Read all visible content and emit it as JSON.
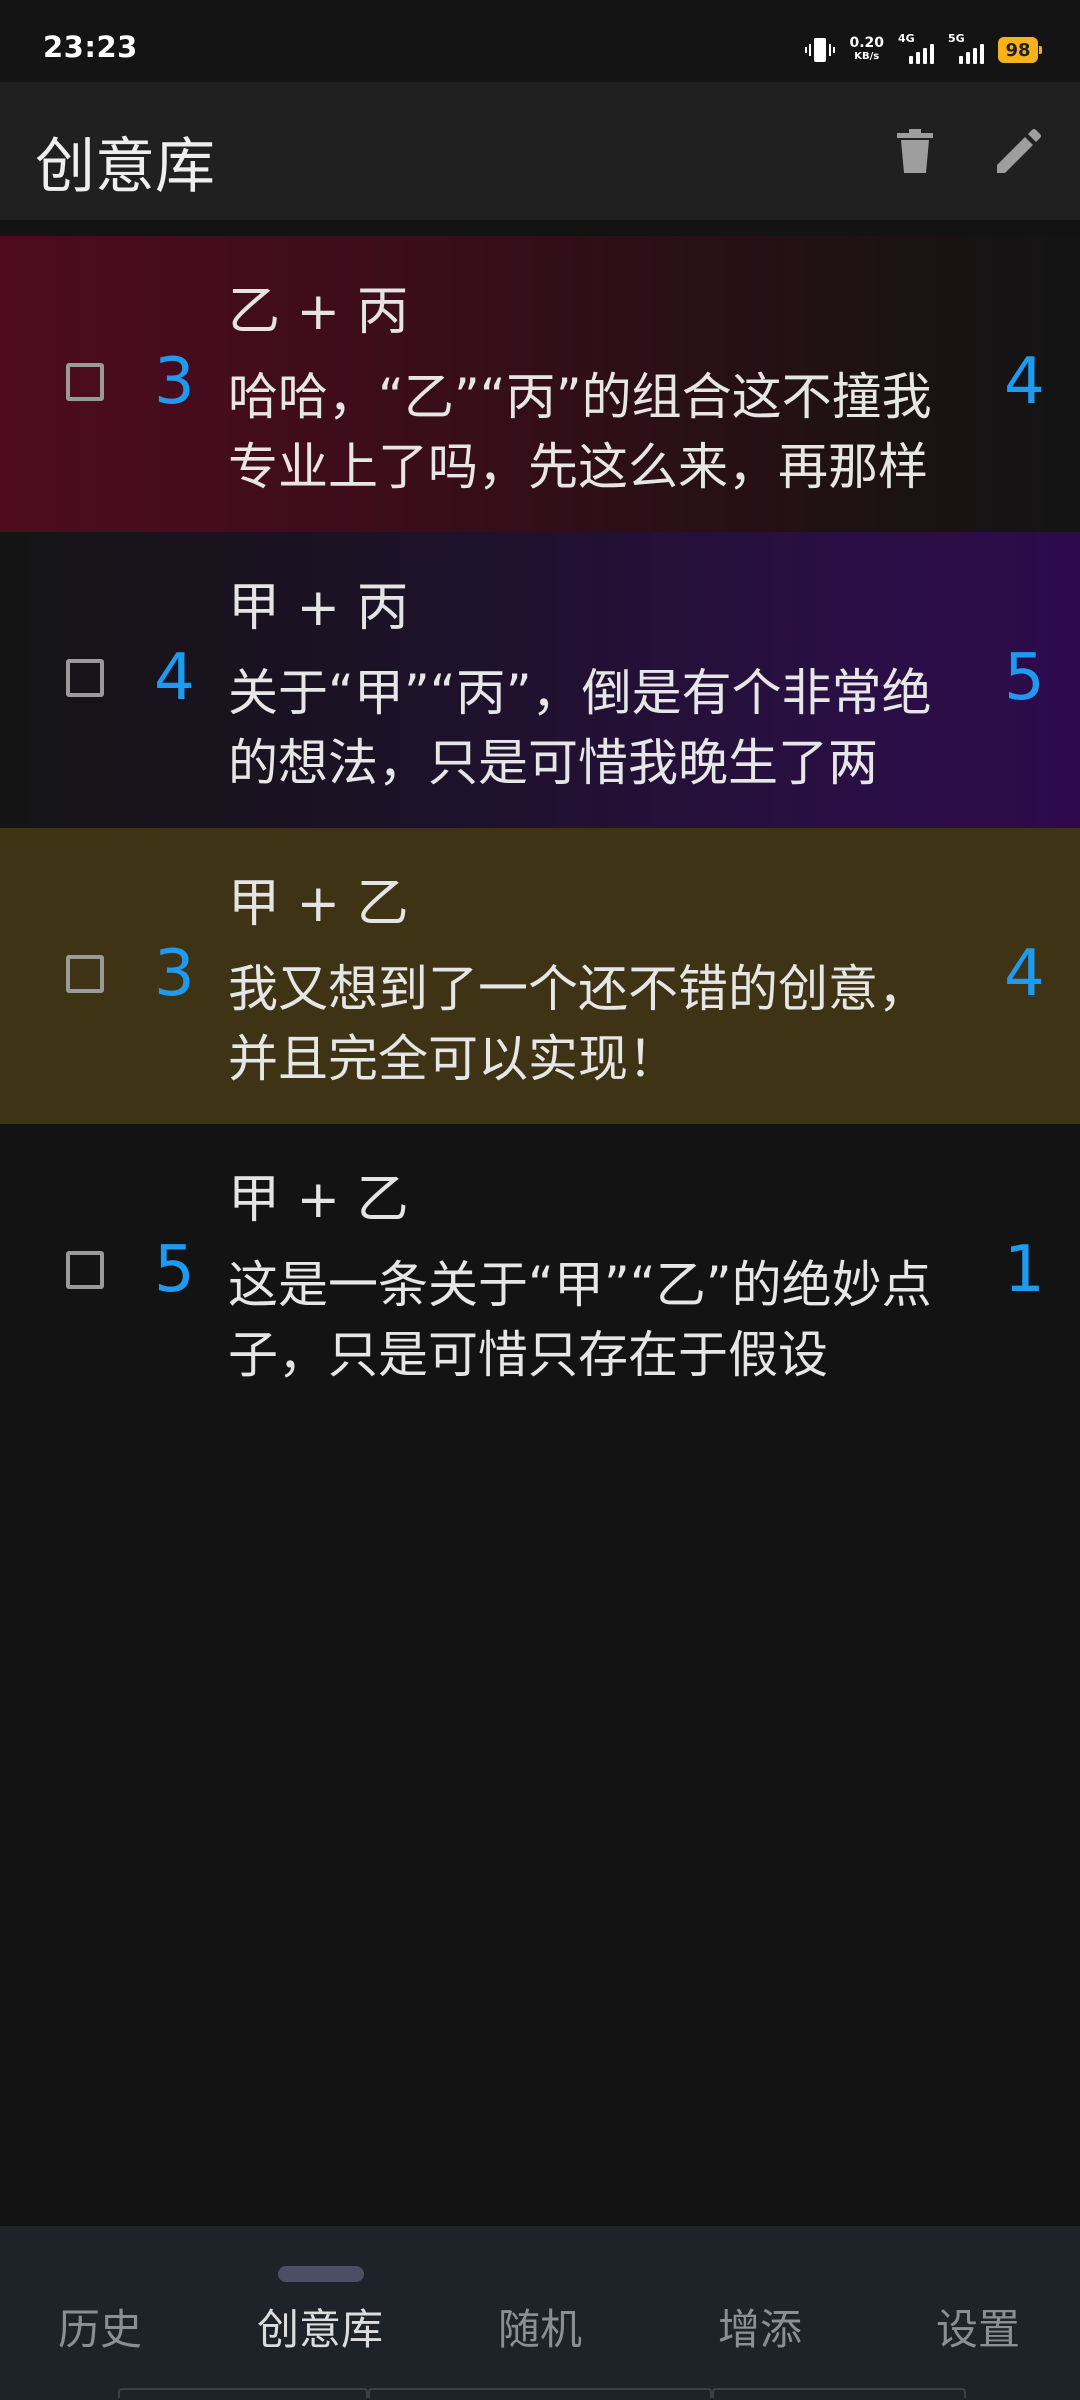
{
  "status_bar": {
    "time": "23:23",
    "net_speed_value": "0.20",
    "net_speed_unit": "KB/s",
    "signal1_label": "4G",
    "signal2_label": "5G",
    "battery": "98"
  },
  "app_bar": {
    "title": "创意库",
    "delete_icon": "trash-icon",
    "edit_icon": "pencil-icon"
  },
  "ideas": [
    {
      "title": "乙 + 丙",
      "description": "哈哈，“乙”“丙”的组合这不撞我专业上了吗，先这么来，再那样搞…",
      "left_score": "3",
      "right_score": "4",
      "checked": false,
      "color": "#4e0b1e"
    },
    {
      "title": "甲 + 丙",
      "description": "关于“甲”“丙”，倒是有个非常绝的想法，只是可惜我晚生了两年，…",
      "left_score": "4",
      "right_score": "5",
      "checked": false,
      "color": "#2e0a4d"
    },
    {
      "title": "甲 + 乙",
      "description": "我又想到了一个还不错的创意，并且完全可以实现！",
      "left_score": "3",
      "right_score": "4",
      "checked": false,
      "color": "#3e3314"
    },
    {
      "title": "甲 + 乙",
      "description": "这是一条关于“甲”“乙”的绝妙点子，只是可惜只存在于假设",
      "left_score": "5",
      "right_score": "1",
      "checked": false,
      "color": "#131313"
    }
  ],
  "bottom_nav": {
    "items": [
      {
        "label": "历史"
      },
      {
        "label": "创意库"
      },
      {
        "label": "随机"
      },
      {
        "label": "增添"
      },
      {
        "label": "设置"
      }
    ],
    "active_index": 1
  }
}
